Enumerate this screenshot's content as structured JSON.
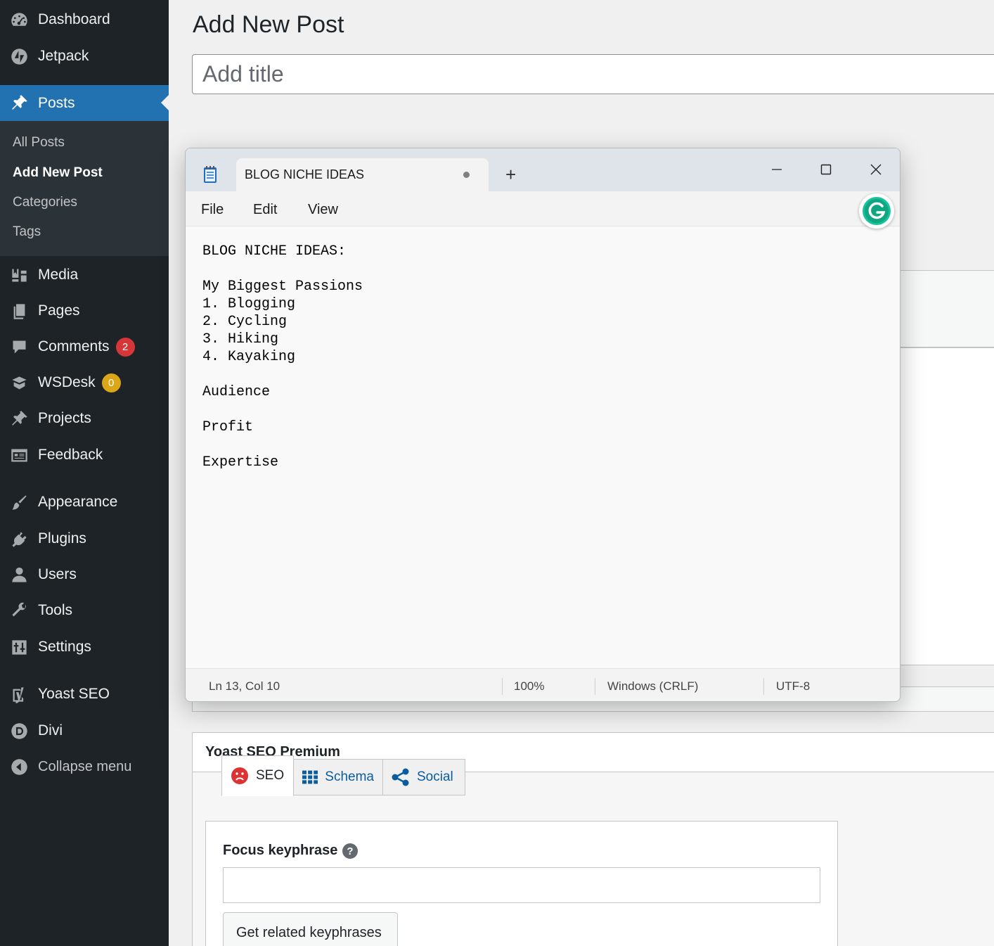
{
  "sidebar": {
    "items": [
      {
        "label": "Dashboard",
        "icon": "dashboard-icon"
      },
      {
        "label": "Jetpack",
        "icon": "jetpack-icon"
      },
      {
        "label": "Posts",
        "icon": "pin-icon",
        "current": true
      },
      {
        "label": "Media",
        "icon": "media-icon"
      },
      {
        "label": "Pages",
        "icon": "pages-icon"
      },
      {
        "label": "Comments",
        "icon": "comment-icon",
        "badge": "2"
      },
      {
        "label": "WSDesk",
        "icon": "wsdesk-icon",
        "badge": "0"
      },
      {
        "label": "Projects",
        "icon": "pin-icon"
      },
      {
        "label": "Feedback",
        "icon": "feedback-icon"
      },
      {
        "label": "Appearance",
        "icon": "brush-icon"
      },
      {
        "label": "Plugins",
        "icon": "plugin-icon"
      },
      {
        "label": "Users",
        "icon": "user-icon"
      },
      {
        "label": "Tools",
        "icon": "wrench-icon"
      },
      {
        "label": "Settings",
        "icon": "settings-icon"
      },
      {
        "label": "Yoast SEO",
        "icon": "yoast-icon"
      },
      {
        "label": "Divi",
        "icon": "divi-icon"
      },
      {
        "label": "Collapse menu",
        "icon": "collapse-icon"
      }
    ],
    "submenu": [
      {
        "label": "All Posts"
      },
      {
        "label": "Add New Post",
        "current": true
      },
      {
        "label": "Categories"
      },
      {
        "label": "Tags"
      }
    ]
  },
  "page": {
    "title": "Add New Post",
    "title_placeholder": "Add title"
  },
  "notepad": {
    "tab_title": "BLOG NICHE IDEAS",
    "new_tab": "+",
    "menu": [
      "File",
      "Edit",
      "View"
    ],
    "content": "BLOG NICHE IDEAS:\n\nMy Biggest Passions\n1. Blogging\n2. Cycling\n3. Hiking\n4. Kayaking\n\nAudience\n\nProfit\n\nExpertise",
    "status": {
      "position": "Ln 13, Col 10",
      "zoom": "100%",
      "line_endings": "Windows (CRLF)",
      "encoding": "UTF-8"
    }
  },
  "yoast": {
    "title": "Yoast SEO Premium",
    "tabs": [
      {
        "label": "SEO",
        "active": true
      },
      {
        "label": "Schema"
      },
      {
        "label": "Social"
      }
    ],
    "focus_label": "Focus keyphrase",
    "help": "?",
    "focus_value": "",
    "related_button": "Get related keyphrases"
  },
  "colors": {
    "sidebar_bg": "#1d2327",
    "sidebar_active": "#2271b1",
    "badge_red": "#d63638",
    "badge_yellow": "#dba617",
    "grammarly_green": "#15c39a",
    "seo_sad_red": "#dc3232",
    "link_blue": "#0a5c9e"
  }
}
